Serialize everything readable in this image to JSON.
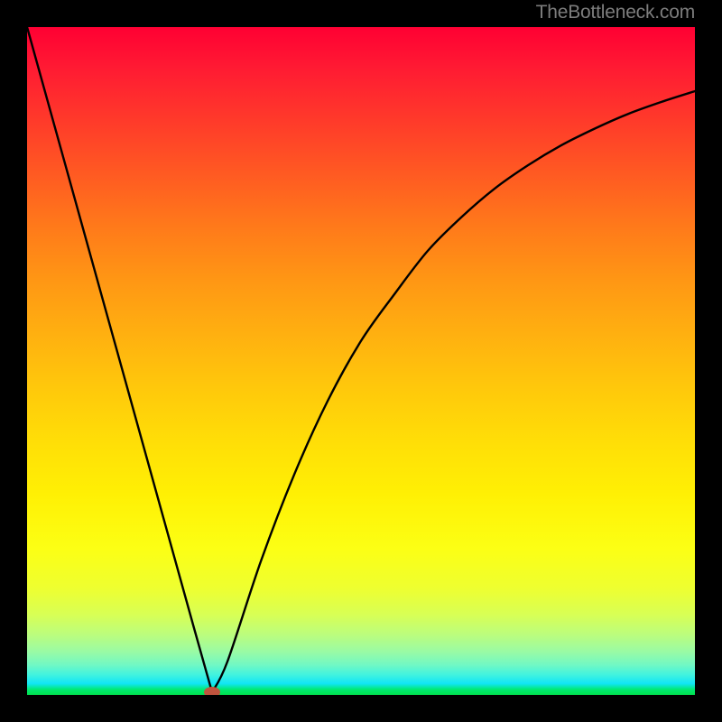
{
  "watermark": {
    "text": "TheBottleneck.com"
  },
  "chart_data": {
    "type": "line",
    "title": "",
    "xlabel": "",
    "ylabel": "",
    "xlim": [
      0,
      100
    ],
    "ylim": [
      0,
      100
    ],
    "background": {
      "gradient_stops": [
        {
          "pos": 0.0,
          "color": "#ff0033"
        },
        {
          "pos": 0.5,
          "color": "#ffc000"
        },
        {
          "pos": 0.78,
          "color": "#fcff14"
        },
        {
          "pos": 0.95,
          "color": "#71f8c4"
        },
        {
          "pos": 1.0,
          "color": "#00e24e"
        }
      ]
    },
    "curve": {
      "description": "V-shaped curve: steep near-linear left branch from top-left down to a minimum near x≈28, then rises and flattens toward the right edge.",
      "data_points_xy": [
        [
          0,
          100
        ],
        [
          5,
          82
        ],
        [
          10,
          64
        ],
        [
          15,
          46
        ],
        [
          20,
          28
        ],
        [
          25,
          10
        ],
        [
          27.7,
          0.4
        ],
        [
          30,
          5
        ],
        [
          35,
          20
        ],
        [
          40,
          33
        ],
        [
          45,
          44
        ],
        [
          50,
          53
        ],
        [
          55,
          60
        ],
        [
          60,
          66.5
        ],
        [
          65,
          71.5
        ],
        [
          70,
          75.8
        ],
        [
          75,
          79.3
        ],
        [
          80,
          82.3
        ],
        [
          85,
          84.8
        ],
        [
          90,
          87
        ],
        [
          95,
          88.8
        ],
        [
          100,
          90.4
        ]
      ]
    },
    "marker": {
      "label": "",
      "x": 27.7,
      "y": 0.4,
      "color": "#c0543e"
    }
  }
}
